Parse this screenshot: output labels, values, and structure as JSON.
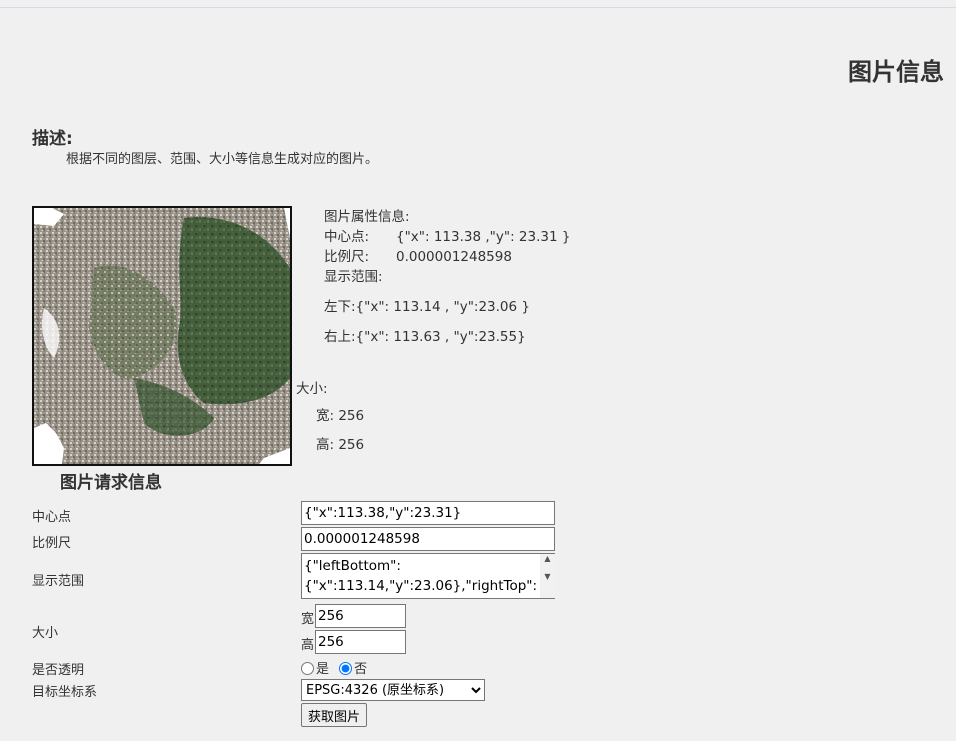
{
  "page": {
    "title": "图片信息",
    "description_heading": "描述:",
    "description_text": "根据不同的图层、范围、大小等信息生成对应的图片。"
  },
  "image_props": {
    "heading": "图片属性信息:",
    "center_label": "中心点:",
    "center_value": "{\"x\": 113.38 ,\"y\": 23.31 }",
    "scale_label": "比例尺:",
    "scale_value": "0.000001248598",
    "extent_label": "显示范围:",
    "lower_left": "左下:{\"x\": 113.14 , \"y\":23.06 }",
    "upper_right": "右上:{\"x\": 113.63 , \"y\":23.55}",
    "size_label": "大小:",
    "width": "宽: 256",
    "height": "高: 256"
  },
  "request": {
    "heading": "图片请求信息",
    "center_label": "中心点",
    "center_value": "{\"x\":113.38,\"y\":23.31}",
    "scale_label": "比例尺",
    "scale_value": "0.000001248598",
    "extent_label": "显示范围",
    "extent_value": "{\"leftBottom\":\n{\"x\":113.14,\"y\":23.06},\"rightTop\":",
    "size_label": "大小",
    "width_label": "宽",
    "width_value": "256",
    "height_label": "高",
    "height_value": "256",
    "transparent_label": "是否透明",
    "yes_label": "是",
    "no_label": "否",
    "transparent_selected": "否",
    "crs_label": "目标坐标系",
    "crs_selected": "EPSG:4326 (原坐标系)",
    "submit_label": "获取图片"
  }
}
